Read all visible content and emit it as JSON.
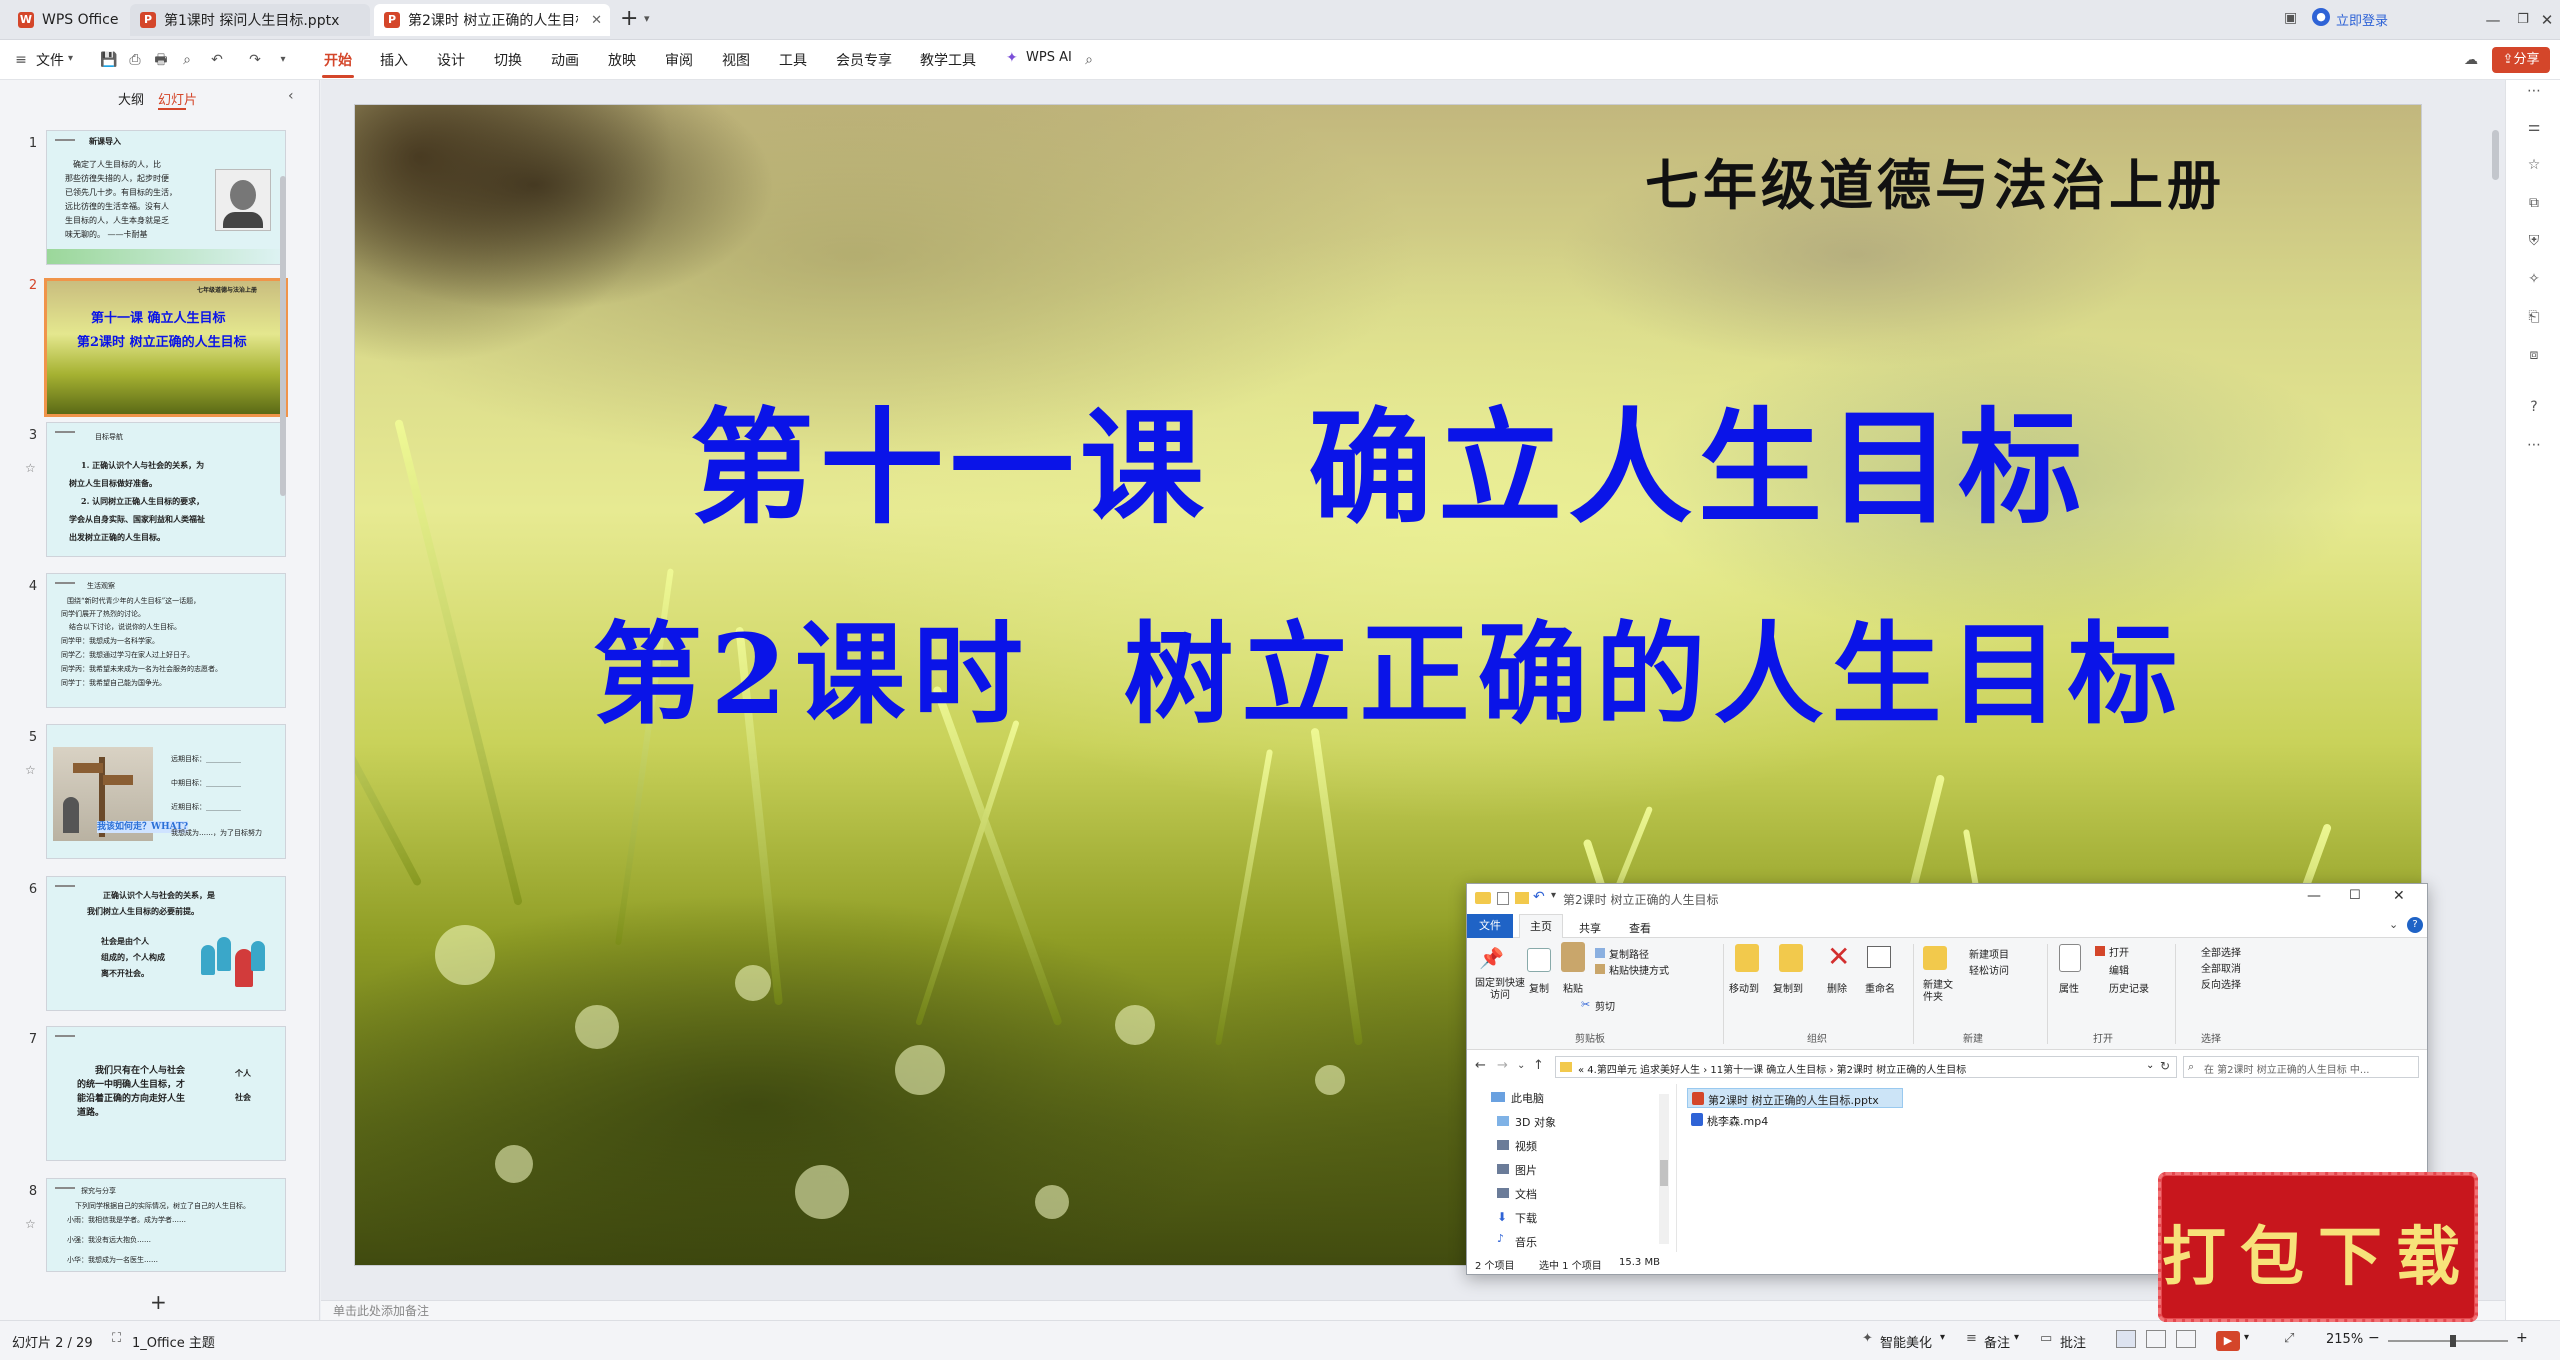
{
  "tabs": [
    {
      "label": "WPS Office",
      "icon": "wps-logo-icon"
    },
    {
      "label": "第1课时 探问人生目标.pptx",
      "icon": "ppt-file-icon"
    },
    {
      "label": "第2课时 树立正确的人生目标",
      "icon": "ppt-file-icon"
    }
  ],
  "titlebar": {
    "new_tab": "+",
    "login": "立即登录"
  },
  "menu": {
    "file": "文件",
    "items": [
      "开始",
      "插入",
      "设计",
      "切换",
      "动画",
      "放映",
      "审阅",
      "视图",
      "工具",
      "会员专享",
      "教学工具"
    ],
    "active": "开始",
    "wps_ai": "WPS AI",
    "share": "分享"
  },
  "leftpanel": {
    "tab_outline": "大纲",
    "tab_slides": "幻灯片",
    "active_tab": "幻灯片",
    "slides": [
      {
        "num": "1",
        "lines": [
          "新课导入",
          "确定了人生目标的人，比",
          "那些彷徨失措的人，起步时便",
          "已领先几十步。有目标的生活，",
          "远比彷徨的生活幸福。没有人",
          "生目标的人，人生本身就是乏",
          "味无聊的。 ——卡耐基"
        ]
      },
      {
        "num": "2",
        "lines": [
          "七年级道德与法治上册",
          "第十一课  确立人生目标",
          "第2课时  树立正确的人生目标"
        ]
      },
      {
        "num": "3",
        "lines": [
          "目标导航",
          "1. 正确认识个人与社会的关系，为",
          "树立人生目标做好准备。",
          "2. 认同树立正确人生目标的要求，",
          "学会从自身实际、国家利益和人类福祉",
          "出发树立正确的人生目标。"
        ]
      },
      {
        "num": "4",
        "lines": [
          "生活观察",
          "围绕“新时代青少年的人生目标”这一话题，",
          "同学们展开了热烈的讨论。",
          "结合以下讨论，说说你的人生目标。",
          "同学甲：我想成为一名科学家。",
          "同学乙：我想通过学习在家人过上好日子。",
          "同学丙：我希望未来成为一名为社会服务的志愿者。",
          "同学丁：我希望自己能为国争光。"
        ]
      },
      {
        "num": "5",
        "lines": [
          "远期目标：__________",
          "中期目标：__________",
          "近期目标：__________",
          "我该如何走？WHAT?",
          "我想成为……，为了目标努力"
        ]
      },
      {
        "num": "6",
        "lines": [
          "正确认识个人与社会的关系，是",
          "我们树立人生目标的必要前提。",
          "社会是由个人",
          "组成的，个人构成",
          "离不开社会。"
        ]
      },
      {
        "num": "7",
        "lines": [
          "我们只有在个人与社会",
          "的统一中明确人生目标，才",
          "能沿着正确的方向走好人生",
          "道路。",
          "个人",
          "社会"
        ]
      },
      {
        "num": "8",
        "lines": [
          "探究与分享",
          "下列同学根据自己的实际情况，树立了自己的人生目标。",
          "小雨：我相信我是学者。成为学者……",
          "小强：我没有远大抱负……",
          "小华：我想成为一名医生……"
        ]
      }
    ],
    "add": "+"
  },
  "slide": {
    "top_title": "七年级道德与法治上册",
    "main_title": "第十一课  确立人生目标",
    "subtitle": "第2课时  树立正确的人生目标"
  },
  "notes_placeholder": "单击此处添加备注",
  "status": {
    "slide_count": "幻灯片 2 / 29",
    "theme": "1_Office 主题",
    "smart": "智能美化",
    "notes": "备注",
    "comments": "批注",
    "zoom": "215%"
  },
  "explorer": {
    "title": "第2课时 树立正确的人生目标",
    "ribbon_tabs": [
      "文件",
      "主页",
      "共享",
      "查看"
    ],
    "active_tab": "主页",
    "groups": {
      "clipboard": {
        "label": "剪贴板",
        "pin": "固定到快速访问",
        "copy": "复制",
        "paste": "粘贴",
        "copy_path": "复制路径",
        "paste_shortcut": "粘贴快捷方式",
        "cut": "剪切"
      },
      "organize": {
        "label": "组织",
        "move_to": "移动到",
        "copy_to": "复制到",
        "delete": "删除",
        "rename": "重命名"
      },
      "new": {
        "label": "新建",
        "new_folder": "新建文件夹",
        "new_item": "新建项目",
        "easy_access": "轻松访问"
      },
      "open": {
        "label": "打开",
        "properties": "属性",
        "open": "打开",
        "edit": "编辑",
        "history": "历史记录"
      },
      "select": {
        "label": "选择",
        "select_all": "全部选择",
        "select_none": "全部取消",
        "invert": "反向选择"
      }
    },
    "breadcrumb": [
      "4.第四单元 追求美好人生",
      "11第十一课 确立人生目标",
      "第2课时 树立正确的人生目标"
    ],
    "search_placeholder": "在 第2课时 树立正确的人生目标 中...",
    "nav": [
      "此电脑",
      "3D 对象",
      "视频",
      "图片",
      "文档",
      "下载",
      "音乐"
    ],
    "files": [
      {
        "name": "第2课时 树立正确的人生目标.pptx",
        "icon": "pptx-file-icon"
      },
      {
        "name": "桃李森.mp4",
        "icon": "video-file-icon"
      }
    ],
    "status": {
      "count": "2 个项目",
      "selected": "选中 1 个项目",
      "size": "15.3 MB"
    }
  },
  "download_badge": "打包下载",
  "colors": {
    "accent": "#d4462a",
    "slide_title": "#0a14e8",
    "badge_red": "#c8161d",
    "badge_text": "#f7e27a"
  }
}
